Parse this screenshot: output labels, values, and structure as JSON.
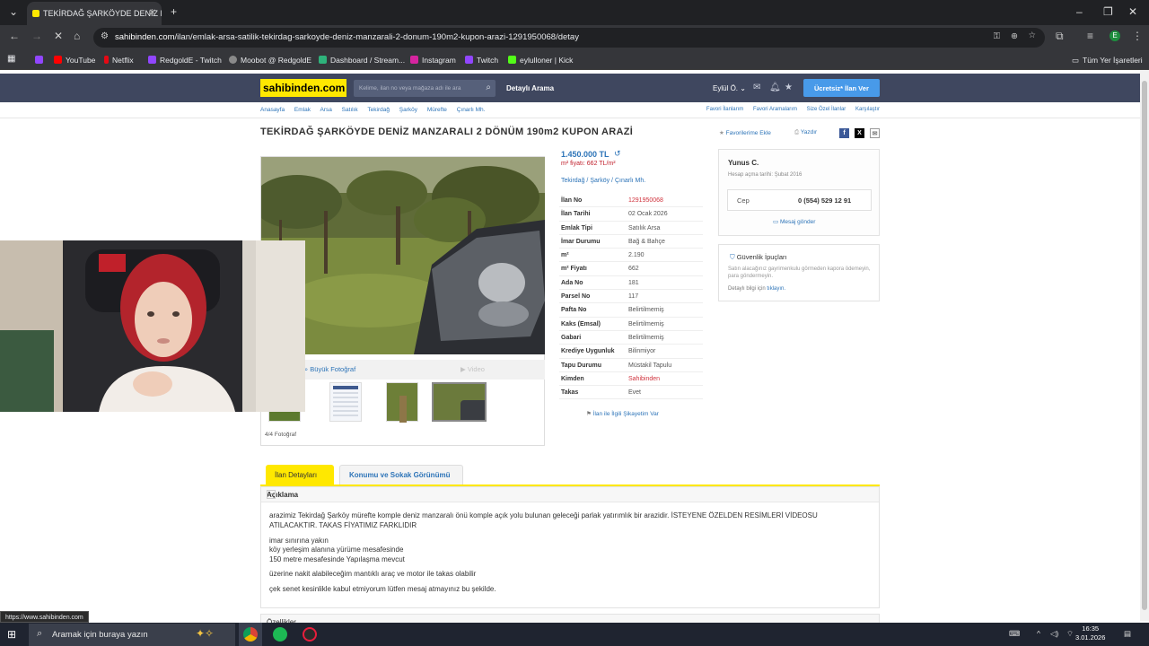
{
  "browser": {
    "tab_title": "TEKİRDAĞ ŞARKÖYDE DENİZ M",
    "url_domain": "sahibinden.com",
    "url_path": "/ilan/emlak-arsa-satilik-tekirdag-sarkoyde-deniz-manzarali-2-donum-190m2-kupon-arazi-1291950068/detay",
    "bookmarks": [
      "YouTube",
      "Netflix",
      "RedgoldE - Twitch",
      "Moobot @ RedgoldE",
      "Dashboard / Stream...",
      "Instagram",
      "Twitch",
      "eylulloner | Kick"
    ],
    "all_bookmarks": "Tüm Yer İşaretleri",
    "status_url": "https://www.sahibinden.com"
  },
  "header": {
    "logo": "sahibinden.com",
    "search_placeholder": "Kelime, ilan no veya mağaza adı ile ara",
    "detailed_search": "Detaylı Arama",
    "user": "Eylül Ö.",
    "post_ad": "Ücretsiz* İlan Ver"
  },
  "breadcrumb": [
    "Anasayfa",
    "Emlak",
    "Arsa",
    "Satılık",
    "Tekirdağ",
    "Şarköy",
    "Mürefte",
    "Çınarlı Mh."
  ],
  "toplinks": [
    "Favori İlanlarım",
    "Favori Aramalarım",
    "Size Özel İlanlar",
    "Karşılaştır"
  ],
  "listing": {
    "title": "TEKİRDAĞ ŞARKÖYDE DENİZ MANZARALI 2 DÖNÜM 190m2 KUPON ARAZİ",
    "add_favorite": "Favorilerime Ekle",
    "print": "Yazdır",
    "price": "1.450.000 TL",
    "m2_price": "m² fiyatı: 662 TL/m²",
    "location": [
      "Tekirdağ",
      "Şarköy",
      "Çınarlı Mh."
    ],
    "big_photo": "Büyük Fotoğraf",
    "video": "Video",
    "photo_count": "4/4 Fotoğraf",
    "complaint": "İlan ile İlgili Şikayetim Var",
    "details": [
      {
        "k": "İlan No",
        "v": "1291950068"
      },
      {
        "k": "İlan Tarihi",
        "v": "02 Ocak 2026"
      },
      {
        "k": "Emlak Tipi",
        "v": "Satılık Arsa"
      },
      {
        "k": "İmar Durumu",
        "v": "Bağ & Bahçe"
      },
      {
        "k": "m²",
        "v": "2.190"
      },
      {
        "k": "m² Fiyatı",
        "v": "662"
      },
      {
        "k": "Ada No",
        "v": "181"
      },
      {
        "k": "Parsel No",
        "v": "117"
      },
      {
        "k": "Pafta No",
        "v": "Belirtilmemiş"
      },
      {
        "k": "Kaks (Emsal)",
        "v": "Belirtilmemiş"
      },
      {
        "k": "Gabari",
        "v": "Belirtilmemiş"
      },
      {
        "k": "Krediye Uygunluk",
        "v": "Bilinmiyor"
      },
      {
        "k": "Tapu Durumu",
        "v": "Müstakil Tapulu"
      },
      {
        "k": "Kimden",
        "v": "Sahibinden"
      },
      {
        "k": "Takas",
        "v": "Evet"
      }
    ]
  },
  "seller": {
    "name": "Yunus C.",
    "since": "Hesap açma tarihi: Şubat 2016",
    "phone_label": "Cep",
    "phone": "0 (554) 529 12 91",
    "message": "Mesaj gönder"
  },
  "security": {
    "title": "Güvenlik İpuçları",
    "text": "Satın alacağınız gayrimenkulu görmeden kapora ödemeyin, para göndermeyin.",
    "more_prefix": "Detaylı bilgi için",
    "more_link": "tıklayın."
  },
  "tabs": [
    "İlan Detayları",
    "Konumu ve Sokak Görünümü"
  ],
  "description": {
    "heading": "Açıklama",
    "lines": [
      "arazimiz Tekirdağ Şarköy mürefte komple deniz manzaralı önü komple açık yolu bulunan geleceği parlak yatırımlık bir arazidir. İSTEYENE ÖZELDEN RESİMLERİ VİDEOSU",
      "ATILACAKTIR. TAKAS FİYATIMIZ FARKLIDIR",
      "imar sınırına yakın",
      "köy yerleşim alanına yürüme mesafesinde",
      "150 metre mesafesinde Yapılaşma mevcut",
      "üzerine nakit alabileceğim mantıklı araç ve motor ile takas olabilir",
      "çek senet kesinlikle kabul etmiyorum lütfen mesaj atmayınız bu şekilde."
    ],
    "features_heading": "Özellikler"
  },
  "taskbar": {
    "search": "Aramak için buraya yazın",
    "time": "16:35",
    "date": "3.01.2026"
  }
}
